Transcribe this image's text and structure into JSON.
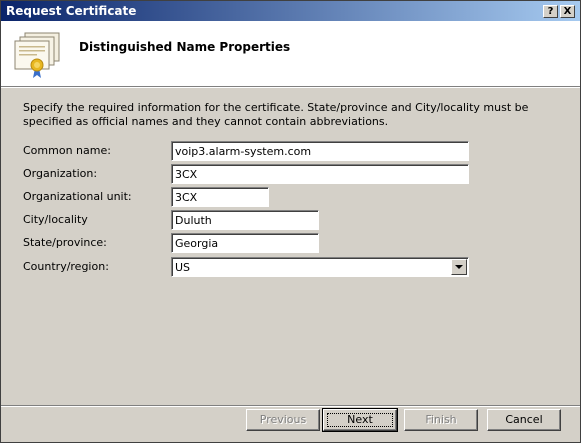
{
  "window": {
    "title": "Request Certificate",
    "help_button": "?",
    "close_button": "X"
  },
  "header": {
    "heading": "Distinguished Name Properties",
    "icon": "certificate-icon"
  },
  "instructions": "Specify the required information for the certificate. State/province and City/locality must be specified as official names and they cannot contain abbreviations.",
  "fields": {
    "common_name": {
      "label": "Common name:",
      "value": "voip3.alarm-system.com"
    },
    "organization": {
      "label": "Organization:",
      "value": "3CX"
    },
    "organizational_unit": {
      "label": "Organizational unit:",
      "value": "3CX"
    },
    "city": {
      "label": "City/locality",
      "value": "Duluth"
    },
    "state": {
      "label": "State/province:",
      "value": "Georgia"
    },
    "country": {
      "label": "Country/region:",
      "value": "US"
    }
  },
  "buttons": {
    "previous": "Previous",
    "next": "Next",
    "finish": "Finish",
    "cancel": "Cancel"
  }
}
